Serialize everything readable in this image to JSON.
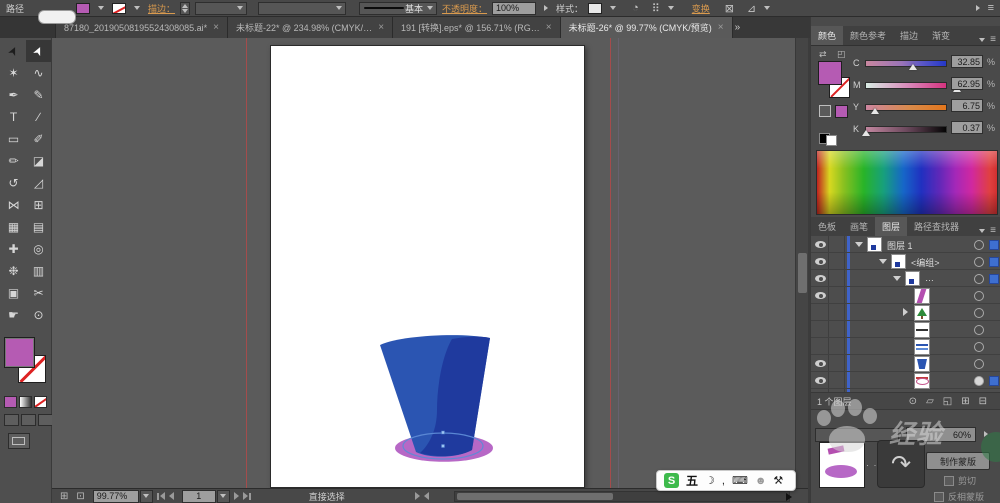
{
  "control_bar": {
    "context_label": "路径",
    "stroke_label": "描边：",
    "brush_name": "基本",
    "opacity_label": "不透明度：",
    "opacity_value": "100%",
    "style_label": "样式：",
    "transform_label": "变换",
    "icons": {
      "recolor": "◔",
      "align": "⠿",
      "transform_a": "⊠",
      "transform_b": "⊿",
      "menu": "≡"
    }
  },
  "tab_bar": {
    "tabs": [
      {
        "title": "87180_20190508195524308085.ai*"
      },
      {
        "title": "未标题-22* @ 234.98% (CMYK/…"
      },
      {
        "title": "191 [转换].eps* @ 156.71% (RG…"
      },
      {
        "title": "未标题-26* @ 99.77% (CMYK/预览)"
      }
    ],
    "close_glyph": "×",
    "overflow_glyph": "»"
  },
  "toolbar": {
    "tools": [
      {
        "name": "selection",
        "glyph": "➤"
      },
      {
        "name": "direct-selection",
        "glyph": "➤"
      },
      {
        "name": "magic-wand",
        "glyph": "✶"
      },
      {
        "name": "lasso",
        "glyph": "∿"
      },
      {
        "name": "pen",
        "glyph": "✒"
      },
      {
        "name": "curvature",
        "glyph": "✎"
      },
      {
        "name": "type",
        "glyph": "T"
      },
      {
        "name": "line-segment",
        "glyph": "∕"
      },
      {
        "name": "rectangle",
        "glyph": "▭"
      },
      {
        "name": "paintbrush",
        "glyph": "✐"
      },
      {
        "name": "pencil",
        "glyph": "✏"
      },
      {
        "name": "eraser",
        "glyph": "◪"
      },
      {
        "name": "rotate",
        "glyph": "↺"
      },
      {
        "name": "scale",
        "glyph": "◿"
      },
      {
        "name": "width",
        "glyph": "⋈"
      },
      {
        "name": "perspective-grid",
        "glyph": "⊞"
      },
      {
        "name": "mesh",
        "glyph": "▦"
      },
      {
        "name": "gradient",
        "glyph": "▤"
      },
      {
        "name": "eyedropper",
        "glyph": "✚"
      },
      {
        "name": "blend",
        "glyph": "◎"
      },
      {
        "name": "symbol-sprayer",
        "glyph": "❉"
      },
      {
        "name": "column-graph",
        "glyph": "▥"
      },
      {
        "name": "artboard",
        "glyph": "▣"
      },
      {
        "name": "slice",
        "glyph": "✂"
      },
      {
        "name": "hand",
        "glyph": "☛"
      },
      {
        "name": "zoom",
        "glyph": "⊙"
      }
    ]
  },
  "color_panel": {
    "tabs": [
      "颜色",
      "颜色参考",
      "描边",
      "渐变"
    ],
    "menu_glyph": "≡",
    "unit": "%",
    "channels": [
      {
        "label": "C",
        "value": "32.85"
      },
      {
        "label": "M",
        "value": "62.95"
      },
      {
        "label": "Y",
        "value": "6.75"
      },
      {
        "label": "K",
        "value": "0.37"
      }
    ]
  },
  "middle_tabs": {
    "tabs": [
      "色板",
      "画笔",
      "图层",
      "路径查找器"
    ],
    "menu_glyph": "≡"
  },
  "layers_panel": {
    "group_rows": [
      {
        "label": "图层 1"
      },
      {
        "label": "<编组>"
      },
      {
        "label": "…"
      }
    ],
    "footer_count": "1 个图层",
    "footer_icons": {
      "locate": "⊙",
      "make_mask": "▱",
      "new_sublayer": "◱",
      "new_layer": "⊞",
      "delete": "⊟"
    }
  },
  "transparency_panel": {
    "opacity_value": "60%",
    "make_mask_label": "制作蒙版",
    "clip_label": "剪切",
    "invert_mask_label": "反相蒙版",
    "swoosh_glyph": "↷"
  },
  "status_bar": {
    "zoom_value": "99.77%",
    "artboard_value": "1",
    "tool_name": "直接选择",
    "icons": {
      "grid": "⊞",
      "export": "⊡"
    }
  },
  "ime_bar": {
    "logo_letter": "S",
    "mode_label": "五",
    "icons": {
      "moon": "☽",
      "comma": ",",
      "keyboard": "⌨",
      "person": "☻",
      "tools": "⚒"
    }
  },
  "watermark": {
    "brand_text": "经验"
  },
  "colors": {
    "fill_magenta": "#b55bb3",
    "accent_link_text": "#d99a4e",
    "selection_blue": "#3e6fd0",
    "cup_light_blue": "#2b55b2",
    "cup_dark_blue": "#1f3a9e",
    "base_ring_blue": "#5d8ad6",
    "disc_purple": "#b768c6"
  }
}
